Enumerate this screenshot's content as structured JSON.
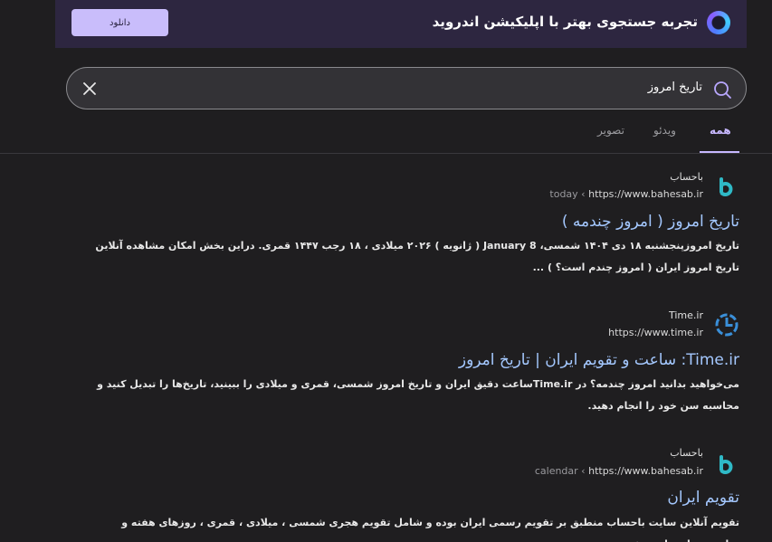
{
  "banner": {
    "title": "تجربه جستجوی بهتر با اپلیکیشن اندروید",
    "download_label": "دانلود"
  },
  "search": {
    "query": "تاریخ امروز"
  },
  "tabs": [
    {
      "label": "همه",
      "active": true
    },
    {
      "label": "ویدئو",
      "active": false
    },
    {
      "label": "تصویر",
      "active": false
    }
  ],
  "results": [
    {
      "site_name": "باحساب",
      "url": "https://www.bahesab.ir",
      "crumb": "today",
      "title": "تاریخ امروز ( امروز چندمه )",
      "snippet": "تاریخ امروزپنجشنبه ۱۸ دی ۱۴۰۴ شمسی، January 8 ( ژانویه ) ۲۰۲۶ میلادی ، ۱۸ رجب ۱۴۴۷ قمری. دراین بخش امکان مشاهده آنلاین تاریخ امروز ایران ( امروز چندم است؟ ) ...",
      "icon": "bahesab-icon"
    },
    {
      "site_name": "Time.ir",
      "url": "https://www.time.ir",
      "crumb": "",
      "title": "Time.ir: ساعت و تقویم ایران | تاریخ امروز",
      "snippet": "می‌خواهید بدانید امروز چندمه؟ در Time.irساعت دقیق ایران و تاریخ امروز شمسی، قمری و میلادی را ببینید، تاریخ‌ها را تبدیل کنید و محاسبه سن خود را انجام دهید.",
      "icon": "time-ir-icon"
    },
    {
      "site_name": "باحساب",
      "url": "https://www.bahesab.ir",
      "crumb": "calendar",
      "title": "تقویم ایران",
      "snippet": "تقویم آنلاین سایت باحساب منطبق بر تقویم رسمی ایران بوده و شامل تقویم هجری شمسی ، میلادی ، قمری ، روزهای هفته و مناسبت های ملی، مذهبی،",
      "icon": "bahesab-icon"
    }
  ],
  "colors": {
    "background": "#1f1e20",
    "banner": "#2d2640",
    "accent": "#c7b8ff",
    "link": "#a4c8ff"
  }
}
